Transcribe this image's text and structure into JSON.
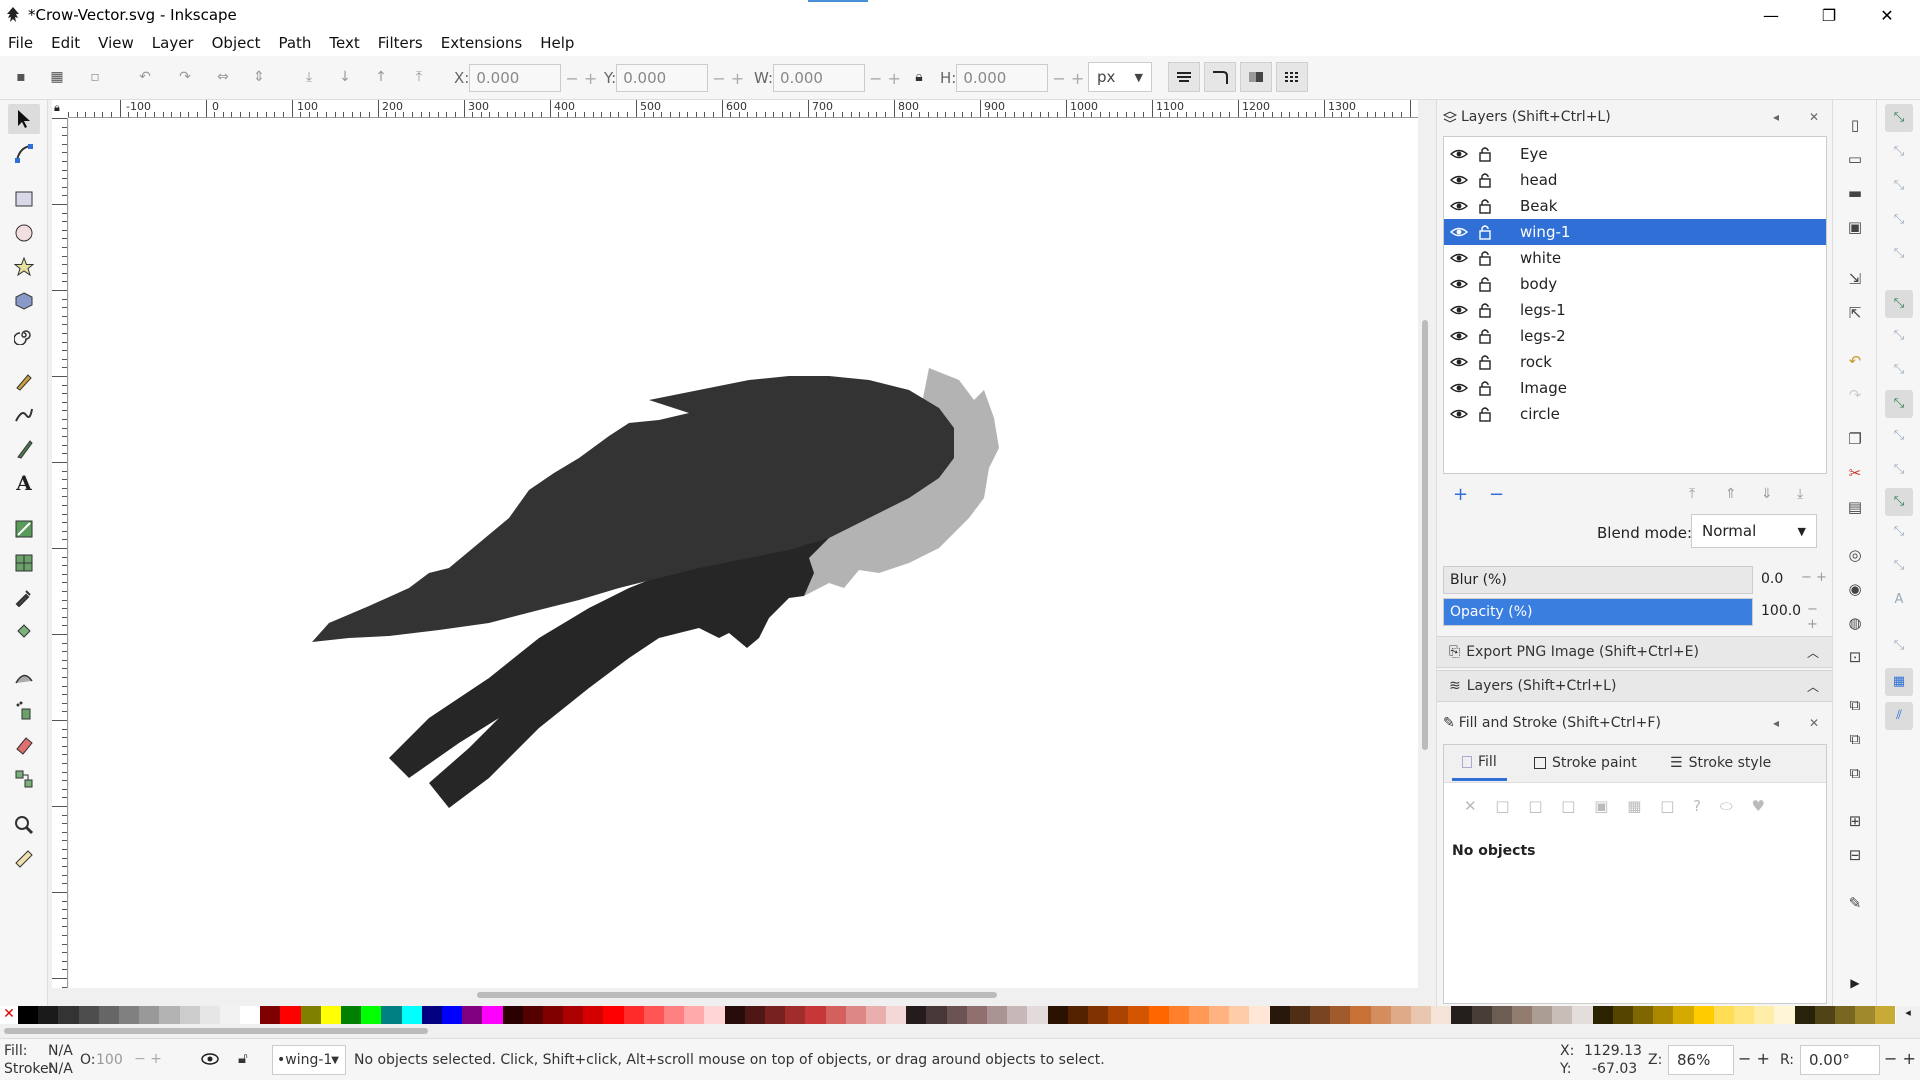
{
  "window": {
    "title": "*Crow-Vector.svg - Inkscape",
    "minimize": "—",
    "maximize": "❐",
    "close": "✕"
  },
  "menu": [
    "File",
    "Edit",
    "View",
    "Layer",
    "Object",
    "Path",
    "Text",
    "Filters",
    "Extensions",
    "Help"
  ],
  "toolbar": {
    "x_label": "X:",
    "x_value": "0.000",
    "y_label": "Y:",
    "y_value": "0.000",
    "w_label": "W:",
    "w_value": "0.000",
    "h_label": "H:",
    "h_value": "0.000",
    "unit": "px"
  },
  "ruler": {
    "labels": [
      "-100",
      "0",
      "100",
      "200",
      "300",
      "400",
      "500",
      "600",
      "700",
      "800",
      "900",
      "1000",
      "1100",
      "1200",
      "1300"
    ]
  },
  "layers_panel": {
    "title": "Layers (Shift+Ctrl+L)",
    "layers": [
      "Eye",
      "head",
      "Beak",
      "wing-1",
      "white",
      "body",
      "legs-1",
      "legs-2",
      "rock",
      "Image",
      "circle"
    ],
    "selected": "wing-1",
    "blend_label": "Blend mode:",
    "blend_value": "Normal",
    "blur_label": "Blur (%)",
    "blur_value": "0.0",
    "opacity_label": "Opacity (%)",
    "opacity_value": "100.0"
  },
  "collapsed_panels": [
    "Export PNG Image (Shift+Ctrl+E)",
    "Layers (Shift+Ctrl+L)"
  ],
  "fill_stroke": {
    "title": "Fill and Stroke (Shift+Ctrl+F)",
    "tabs": [
      "Fill",
      "Stroke paint",
      "Stroke style"
    ],
    "message": "No objects"
  },
  "status": {
    "fill_label": "Fill:",
    "fill_value": "N/A",
    "stroke_label": "Stroke:",
    "stroke_value": "N/A",
    "opacity_label": "O:",
    "opacity_value": "100",
    "layer": "•wing-1",
    "message": "No objects selected. Click, Shift+click, Alt+scroll mouse on top of objects, or drag around objects to select.",
    "x_label": "X:",
    "x_value": "1129.13",
    "y_label": "Y:",
    "y_value": "-67.03",
    "zoom_label": "Z:",
    "zoom_value": "86%",
    "rotate_label": "R:",
    "rotate_value": "0.00°"
  },
  "colors": {
    "accent": "#2f6fd6",
    "wing_dark": "#333333",
    "wing_light": "#b3b3b3",
    "body_dark": "#262626"
  },
  "palette": [
    "#000000",
    "#1a1a1a",
    "#333333",
    "#4d4d4d",
    "#666666",
    "#808080",
    "#999999",
    "#b3b3b3",
    "#cccccc",
    "#e6e6e6",
    "#f2f2f2",
    "#ffffff",
    "#800000",
    "#ff0000",
    "#808000",
    "#ffff00",
    "#008000",
    "#00ff00",
    "#008080",
    "#00ffff",
    "#000080",
    "#0000ff",
    "#800080",
    "#ff00ff",
    "#2b0000",
    "#550000",
    "#800000",
    "#aa0000",
    "#d40000",
    "#ff0000",
    "#ff2a2a",
    "#ff5555",
    "#ff8080",
    "#ffaaaa",
    "#ffd5d5",
    "#280b0b",
    "#501616",
    "#782121",
    "#a02c2c",
    "#c83737",
    "#d35f5f",
    "#de8787",
    "#e9afaf",
    "#f4d7d7",
    "#241c1c",
    "#483737",
    "#6c5353",
    "#916f6f",
    "#ac9393",
    "#c8b7b7",
    "#e3dbdb",
    "#2b1100",
    "#552200",
    "#803300",
    "#aa4400",
    "#d45500",
    "#ff6600",
    "#ff7f2a",
    "#ff9955",
    "#ffb380",
    "#ffccaa",
    "#ffe6d5",
    "#28170b",
    "#502d16",
    "#784421",
    "#a05a2c",
    "#c87137",
    "#d38d5f",
    "#deaa87",
    "#e9c6af",
    "#f4e3d7",
    "#241f1c",
    "#483e37",
    "#6c5d53",
    "#917c6f",
    "#ac9d93",
    "#c8beb7",
    "#e3dedb",
    "#2b2200",
    "#554400",
    "#806600",
    "#aa8800",
    "#d4aa00",
    "#ffcc00",
    "#ffdd55",
    "#ffe680",
    "#ffeeaa",
    "#fff6d5",
    "#28220b",
    "#504416",
    "#786721",
    "#a0892c",
    "#c8ab37"
  ]
}
